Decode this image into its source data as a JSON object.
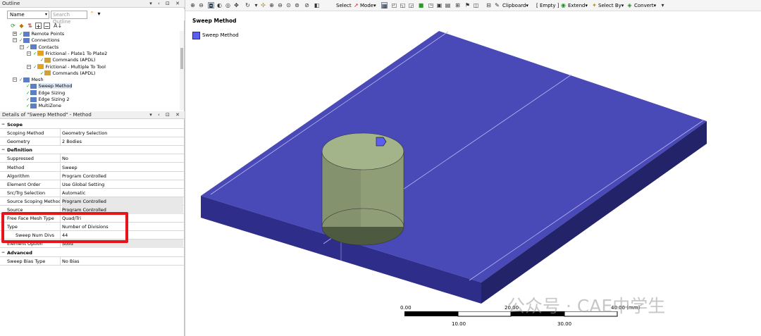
{
  "outline": {
    "title": "Outline",
    "header_icons": "▾ ‹ ⊡ ✕",
    "name_combo": "Name",
    "search_placeholder": "Search Outline",
    "tree": [
      {
        "label": "Remote Points",
        "indent": 1,
        "exp": "+",
        "check": true
      },
      {
        "label": "Connections",
        "indent": 1,
        "exp": "−",
        "check": true
      },
      {
        "label": "Contacts",
        "indent": 2,
        "exp": "−",
        "check": true
      },
      {
        "label": "Frictional - Plate1 To Plate2",
        "indent": 3,
        "exp": "−",
        "check": true
      },
      {
        "label": "Commands (APDL)",
        "indent": 4,
        "exp": "",
        "check": true
      },
      {
        "label": "Frictional - Multiple To Tool",
        "indent": 3,
        "exp": "−",
        "check": true
      },
      {
        "label": "Commands (APDL)",
        "indent": 4,
        "exp": "",
        "check": true
      },
      {
        "label": "Mesh",
        "indent": 1,
        "exp": "−",
        "check": true
      },
      {
        "label": "Sweep Method",
        "indent": 2,
        "exp": "",
        "check": true,
        "selected": true
      },
      {
        "label": "Edge Sizing",
        "indent": 2,
        "exp": "",
        "check": true
      },
      {
        "label": "Edge Sizing 2",
        "indent": 2,
        "exp": "",
        "check": true
      },
      {
        "label": "MultiZone",
        "indent": 2,
        "exp": "",
        "check": true
      }
    ]
  },
  "details": {
    "title": "Details of \"Sweep Method\" - Method",
    "header_icons": "▾ ‹ ⊡ ✕",
    "rows": [
      {
        "type": "cat",
        "k": "Scope",
        "exp": "−"
      },
      {
        "type": "row",
        "k": "Scoping Method",
        "v": "Geometry Selection"
      },
      {
        "type": "row",
        "k": "Geometry",
        "v": "2 Bodies"
      },
      {
        "type": "cat",
        "k": "Definition",
        "exp": "−"
      },
      {
        "type": "row",
        "k": "Suppressed",
        "v": "No"
      },
      {
        "type": "row",
        "k": "Method",
        "v": "Sweep"
      },
      {
        "type": "row",
        "k": "Algorithm",
        "v": "Program Controlled"
      },
      {
        "type": "row",
        "k": "Element Order",
        "v": "Use Global Setting"
      },
      {
        "type": "row",
        "k": "Src/Trg Selection",
        "v": "Automatic"
      },
      {
        "type": "row",
        "k": "Source Scoping Method",
        "v": "Program Controlled",
        "grey": true
      },
      {
        "type": "row",
        "k": "Source",
        "v": "Program Controlled",
        "grey": true
      },
      {
        "type": "row",
        "k": "Free Face Mesh Type",
        "v": "Quad/Tri"
      },
      {
        "type": "row",
        "k": "Type",
        "v": "Number of Divisions"
      },
      {
        "type": "row",
        "k": "Sweep Num Divs",
        "v": "44",
        "indent": true
      },
      {
        "type": "row",
        "k": "Element Option",
        "v": "Solid",
        "grey": true
      },
      {
        "type": "cat",
        "k": "Advanced",
        "exp": "−"
      },
      {
        "type": "row",
        "k": "Sweep Bias Type",
        "v": "No Bias"
      }
    ]
  },
  "toolbar": {
    "select": "Select",
    "mode": "Mode▾",
    "clipboard": "Clipboard▾",
    "empty": "[ Empty ]",
    "extend": "Extend▾",
    "select_by": "Select By▾",
    "convert": "Convert▾"
  },
  "viewport": {
    "title": "Sweep Method",
    "legend": "Sweep Method",
    "colors": {
      "plate_top": "#4a49b8",
      "plate_side": "#2a2a7a",
      "cylinder": "#8fa878",
      "marker": "#5a5ff0"
    },
    "scale": {
      "top": [
        "0.00",
        "20.00",
        "40.00 (mm)"
      ],
      "bottom": [
        "10.00",
        "30.00"
      ]
    }
  },
  "watermark": "公众号 · CAE中学生"
}
